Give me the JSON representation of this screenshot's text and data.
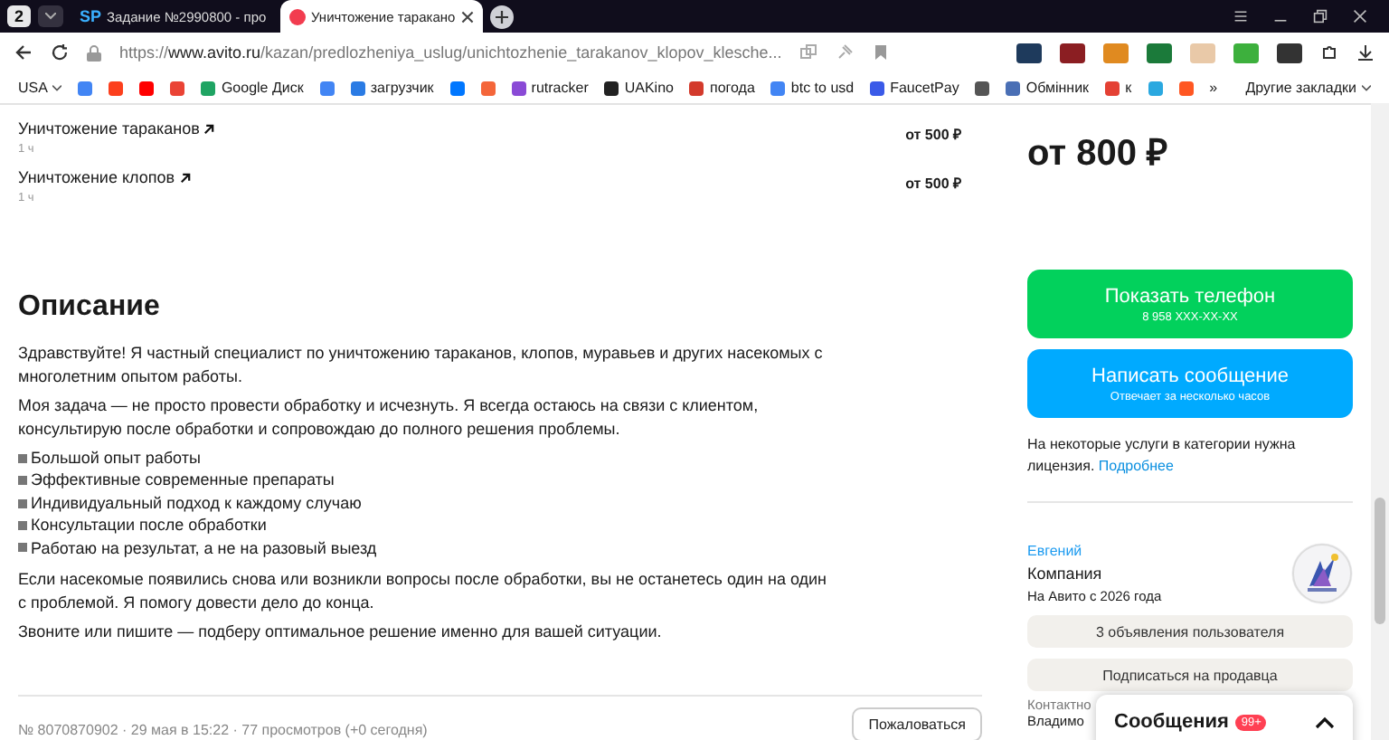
{
  "browser": {
    "tab_count": "2",
    "tabs": [
      {
        "icon": "SP",
        "title": "Задание №2990800 - про",
        "selected": false
      },
      {
        "title": "Уничтожение таракано",
        "selected": true
      }
    ],
    "address": "https://**www.avito.ru**/kazan/predlozheniya_uslug/unichtozhenie_tarakanov_klopov_klesche...",
    "bookmarks_profile": "USA",
    "bookmarks": [
      {
        "color": "#4285f4"
      },
      {
        "color": "#fc3f1d"
      },
      {
        "color": "#ff0000"
      },
      {
        "color": "#ea4335"
      },
      {
        "color": "#1fa463",
        "label": "Google Диск"
      },
      {
        "color": "#4285f4"
      },
      {
        "color": "#2a7be4",
        "label": "загрузчик"
      },
      {
        "color": "#0077ff"
      },
      {
        "color": "#f4663a"
      },
      {
        "color": "#8a4ad6",
        "label": "rutracker"
      },
      {
        "color": "#222222",
        "label": "UAKino"
      },
      {
        "color": "#d33a2c",
        "label": "погода"
      },
      {
        "color": "#4285f4",
        "label": "btc to usd"
      },
      {
        "color": "#3a5ae8",
        "label": "FaucetPay"
      },
      {
        "color": "#555555"
      },
      {
        "color": "#4a6fb5",
        "label": "Обмінник"
      },
      {
        "color": "#e44134",
        "label": "к"
      },
      {
        "color": "#2aa8e0"
      },
      {
        "color": "#ff5722"
      }
    ],
    "more": "»",
    "other_bookmarks": "Другие закладки"
  },
  "services": [
    {
      "name": "Уничтожение тараканов",
      "duration": "1 ч",
      "price": "от 500 ₽"
    },
    {
      "name": "Уничтожение клопов",
      "duration": "1 ч",
      "price": "от 500 ₽"
    }
  ],
  "description": {
    "title": "Описание",
    "intro": [
      "Здравствуйте! Я частный специалист по уничтожению тараканов, клопов, муравьев и других насекомых с многолетним опытом работы.",
      "Моя задача — не просто провести обработку и исчезнуть. Я всегда остаюсь на связи с клиентом, консультирую после обработки и сопровождаю до полного решения проблемы."
    ],
    "bullets": [
      "Большой опыт работы",
      "Эффективные современные препараты",
      "Индивидуальный подход к каждому случаю",
      "Консультации после обработки",
      "Работаю на результат, а не на разовый выезд"
    ],
    "outro": [
      "Если насекомые появились снова или возникли вопросы после обработки, вы не останетесь один на один с проблемой. Я помогу довести дело до конца.",
      "Звоните или пишите — подберу оптимальное решение именно для вашей ситуации."
    ]
  },
  "footer": {
    "meta": "№ 8070870902 · 29 мая в 15:22 · 77 просмотров (+0 сегодня)",
    "report_button": "Пожаловаться"
  },
  "sidebar": {
    "price": "от 800 ₽",
    "phone_button": {
      "label": "Показать телефон",
      "sub": "8 958 XXX-XX-XX"
    },
    "message_button": {
      "label": "Написать сообщение",
      "sub": "Отвечает за несколько часов"
    },
    "license_note": "На некоторые услуги в категории нужна лицензия.",
    "license_link": "Подробнее",
    "seller": {
      "name": "Евгений",
      "type": "Компания",
      "since": "На Авито с 2026 года"
    },
    "ads_button": "3 объявления пользователя",
    "subscribe_button": "Подписаться на продавца",
    "contact_label": "Контактно",
    "contact_name": "Владимо"
  },
  "messages": {
    "title": "Сообщения",
    "badge": "99+"
  }
}
